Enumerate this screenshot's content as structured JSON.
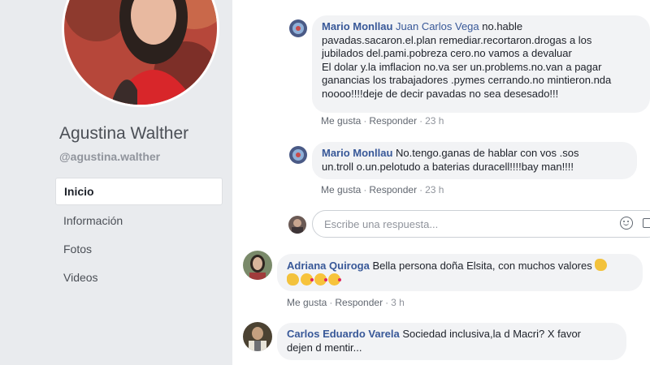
{
  "profile": {
    "name": "Agustina Walther",
    "handle": "@agustina.walther"
  },
  "nav": {
    "items": [
      {
        "label": "Inicio",
        "active": true
      },
      {
        "label": "Información",
        "active": false
      },
      {
        "label": "Fotos",
        "active": false
      },
      {
        "label": "Videos",
        "active": false
      }
    ]
  },
  "comments": [
    {
      "author": "Mario Monllau",
      "mention": "Juan Carlos Vega",
      "text_lines": [
        " no.hable",
        "pavadas.sacaron.el.plan remediar.recortaron.drogas a los",
        "jubilados del.pami.pobreza cero.no vamos a devaluar",
        "El dolar y.la imflacion no.va ser un.problems.no.van a pagar",
        "ganancias los trabajadores .pymes cerrando.no mintieron.nda",
        "noooo!!!!deje de decir pavadas no sea desesado!!!"
      ],
      "like": "Me gusta",
      "reply": "Responder",
      "time": "23 h"
    },
    {
      "author": "Mario Monllau",
      "text_lines": [
        " No.tengo.ganas de hablar con vos .sos",
        "un.troll o.un.pelotudo a baterias duracell!!!!bay man!!!!"
      ],
      "like": "Me gusta",
      "reply": "Responder",
      "time": "23 h"
    },
    {
      "author": "Adriana Quiroga",
      "text_lines": [
        " Bella persona doña Elsita, con muchos valores"
      ],
      "like": "Me gusta",
      "reply": "Responder",
      "time": "3 h"
    },
    {
      "author": "Carlos Eduardo Varela",
      "text_lines": [
        " Sociedad inclusiva,la d Macri? X favor",
        "dejen d mentir..."
      ]
    }
  ],
  "reply_box": {
    "placeholder": "Escribe una respuesta..."
  },
  "icons": {
    "emoji_reaction": "smile-icon",
    "photo_attach": "camera-icon"
  },
  "colors": {
    "link_blue": "#385898",
    "page_bg": "#e9ebee",
    "bubble_bg": "#f2f3f5"
  }
}
